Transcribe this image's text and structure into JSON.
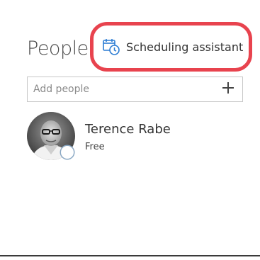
{
  "people": {
    "title": "People",
    "scheduling_button": {
      "label": "Scheduling assistant",
      "icon": "calendar-clock-icon",
      "highlight_color": "#e8434e",
      "icon_color": "#2b7cd3"
    },
    "add_field": {
      "placeholder": "Add people",
      "value": "",
      "add_icon": "plus-icon"
    },
    "attendees": [
      {
        "name": "Terence Rabe",
        "status": "Free",
        "presence_icon": "presence-indicator"
      }
    ]
  }
}
